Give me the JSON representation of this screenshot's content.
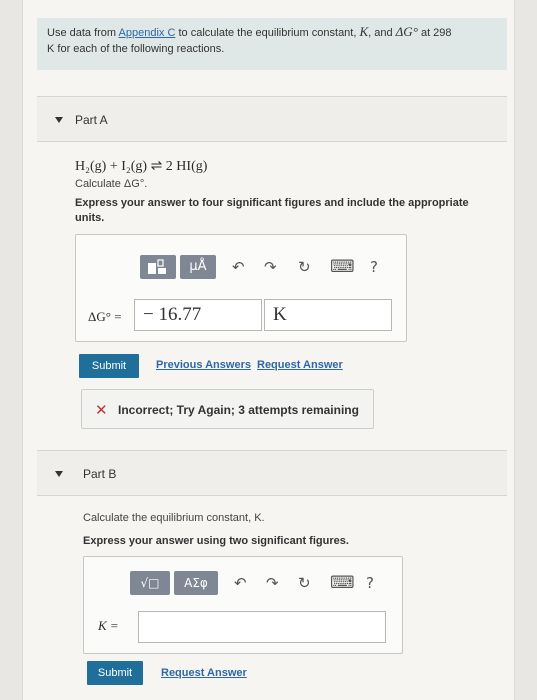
{
  "intro": {
    "text_1": "Use data from ",
    "appendix_link": "Appendix C",
    "text_2": " to calculate the equilibrium constant, ",
    "K_symbol": "K",
    "text_3": ", and ",
    "deltaG_symbol": "ΔG°",
    "text_4": " at 298",
    "text_5": " K for each of the following reactions."
  },
  "part_a": {
    "header_label": "Part A",
    "reaction": "H₂(g) + I₂(g) ⇌ 2 HI(g)",
    "question": "Calculate ΔG°.",
    "instruction": "Express your answer to four significant figures and include the appropriate units.",
    "toolbar": {
      "template_icon": "template-icon",
      "units_button": "μÅ",
      "undo_icon": "↶",
      "redo_icon": "↷",
      "reset_icon": "↻",
      "keyboard_icon": "⌨",
      "help_icon": "?"
    },
    "var_label": "ΔG° =",
    "value": "− 16.77",
    "units": "K",
    "submit_label": "Submit",
    "previous_answers": "Previous Answers",
    "request_answer": "Request Answer",
    "feedback_icon": "✕",
    "feedback": "Incorrect; Try Again; 3 attempts remaining"
  },
  "part_b": {
    "header_label": "Part B",
    "question": "Calculate the equilibrium constant, K.",
    "instruction": "Express your answer using two significant figures.",
    "toolbar": {
      "template_icon": "template-icon",
      "sqrt_symbol": "√□",
      "greek_button": "ΑΣφ",
      "undo_icon": "↶",
      "redo_icon": "↷",
      "reset_icon": "↻",
      "keyboard_icon": "⌨",
      "help_icon": "?"
    },
    "var_label": "K =",
    "value": "",
    "submit_label": "Submit",
    "request_answer": "Request Answer"
  },
  "colors": {
    "accent_blue": "#1f6f9a",
    "link_blue": "#2c68a8",
    "error_red": "#c0392b",
    "intro_bg": "#dfe8e6"
  }
}
